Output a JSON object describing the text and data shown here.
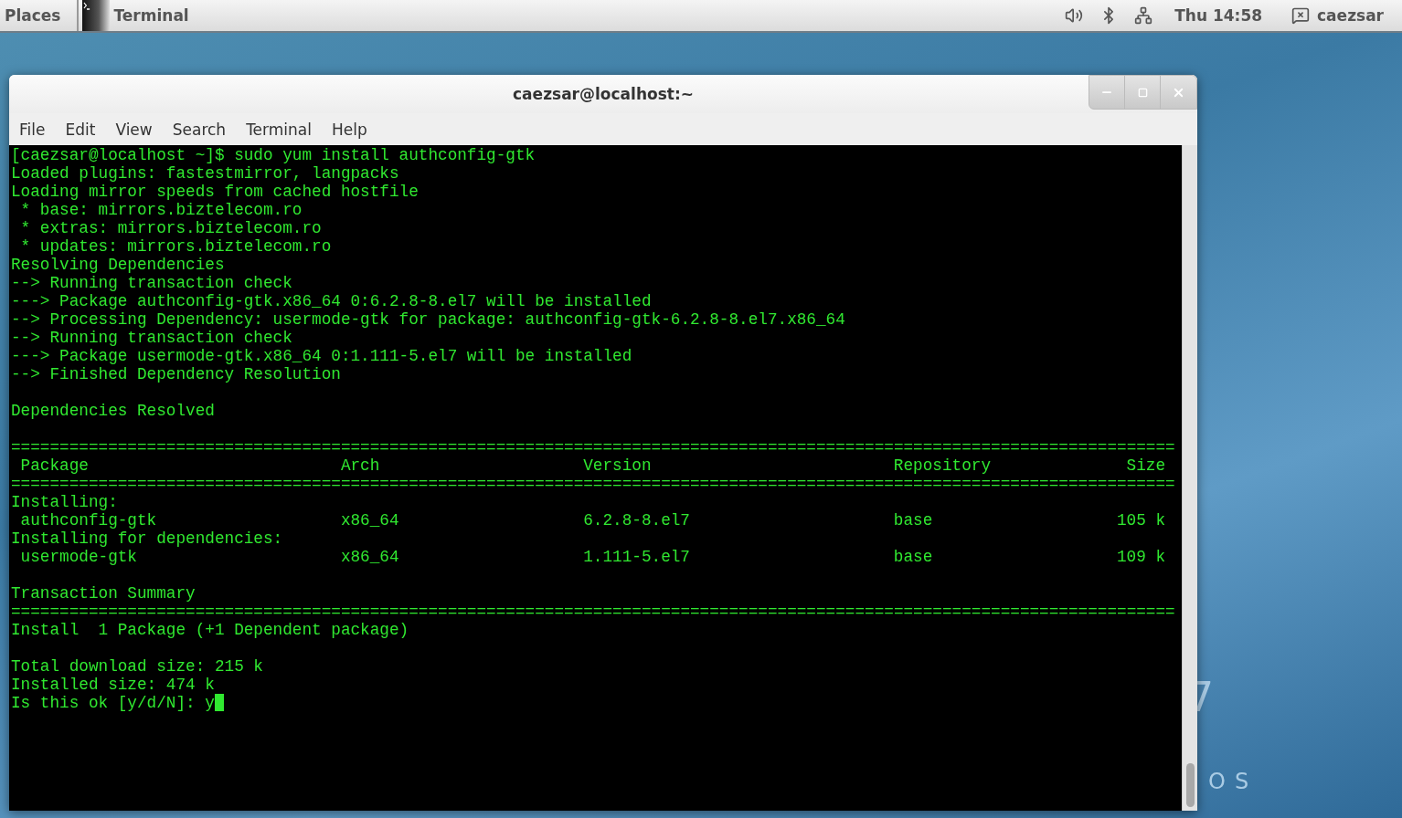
{
  "top_bar": {
    "places": "Places",
    "activity": "Terminal",
    "clock": "Thu 14:58",
    "user": "caezsar"
  },
  "wallpaper": {
    "number": "7",
    "text": "OS"
  },
  "window": {
    "title": "caezsar@localhost:~",
    "menu": [
      "File",
      "Edit",
      "View",
      "Search",
      "Terminal",
      "Help"
    ],
    "terminal": [
      {
        "kind": "line",
        "text": "[caezsar@localhost ~]$ sudo yum install authconfig-gtk"
      },
      {
        "kind": "line",
        "text": "Loaded plugins: fastestmirror, langpacks"
      },
      {
        "kind": "line",
        "text": "Loading mirror speeds from cached hostfile"
      },
      {
        "kind": "line",
        "text": " * base: mirrors.biztelecom.ro"
      },
      {
        "kind": "line",
        "text": " * extras: mirrors.biztelecom.ro"
      },
      {
        "kind": "line",
        "text": " * updates: mirrors.biztelecom.ro"
      },
      {
        "kind": "line",
        "text": "Resolving Dependencies"
      },
      {
        "kind": "line",
        "text": "--> Running transaction check"
      },
      {
        "kind": "line",
        "text": "---> Package authconfig-gtk.x86_64 0:6.2.8-8.el7 will be installed"
      },
      {
        "kind": "line",
        "text": "--> Processing Dependency: usermode-gtk for package: authconfig-gtk-6.2.8-8.el7.x86_64"
      },
      {
        "kind": "line",
        "text": "--> Running transaction check"
      },
      {
        "kind": "line",
        "text": "---> Package usermode-gtk.x86_64 0:1.111-5.el7 will be installed"
      },
      {
        "kind": "line",
        "text": "--> Finished Dependency Resolution"
      },
      {
        "kind": "blank"
      },
      {
        "kind": "line",
        "text": "Dependencies Resolved"
      },
      {
        "kind": "blank"
      },
      {
        "kind": "rule",
        "text": "========================================================================================================================"
      },
      {
        "kind": "row",
        "cells": [
          "Package",
          "Arch",
          "Version",
          "Repository",
          "Size"
        ]
      },
      {
        "kind": "rule",
        "text": "========================================================================================================================"
      },
      {
        "kind": "line",
        "text": "Installing:"
      },
      {
        "kind": "row",
        "cells": [
          "authconfig-gtk",
          "x86_64",
          "6.2.8-8.el7",
          "base",
          "105 k"
        ]
      },
      {
        "kind": "line",
        "text": "Installing for dependencies:"
      },
      {
        "kind": "row",
        "cells": [
          "usermode-gtk",
          "x86_64",
          "1.111-5.el7",
          "base",
          "109 k"
        ]
      },
      {
        "kind": "blank"
      },
      {
        "kind": "line",
        "text": "Transaction Summary"
      },
      {
        "kind": "rule",
        "text": "========================================================================================================================"
      },
      {
        "kind": "line",
        "text": "Install  1 Package (+1 Dependent package)"
      },
      {
        "kind": "blank"
      },
      {
        "kind": "line",
        "text": "Total download size: 215 k"
      },
      {
        "kind": "line",
        "text": "Installed size: 474 k"
      },
      {
        "kind": "prompt",
        "text": "Is this ok [y/d/N]: y",
        "cursor": true
      }
    ]
  }
}
